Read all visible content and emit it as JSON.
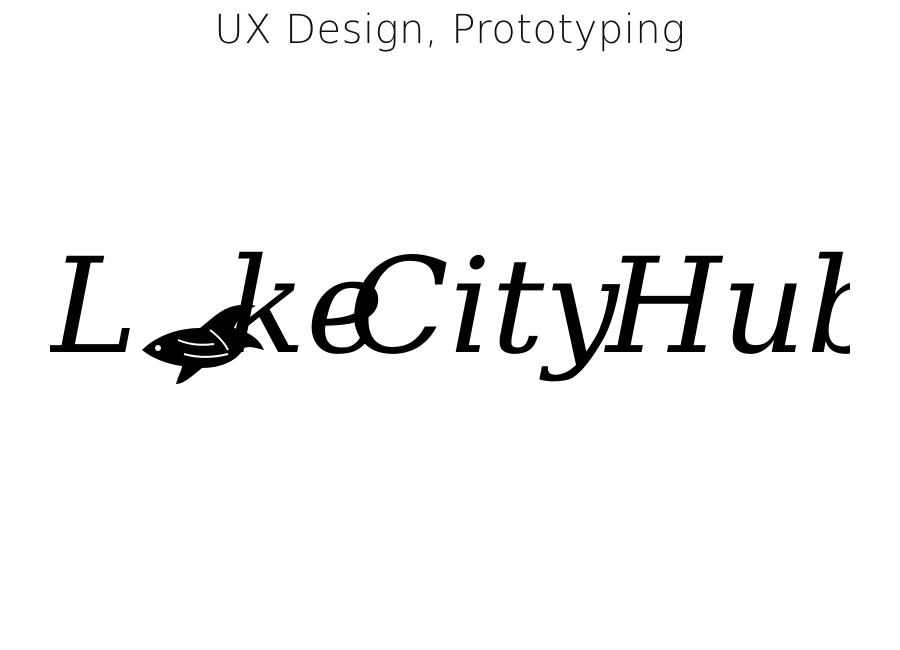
{
  "header": {
    "subtitle": "UX Design, Prototyping"
  },
  "logo": {
    "letter_l": "L",
    "rest_word1": "ke",
    "word2": "City",
    "word3": "Hub",
    "accessible_name": "Lake City Hub",
    "fish_icon": "fish-icon",
    "color": "#000000"
  }
}
